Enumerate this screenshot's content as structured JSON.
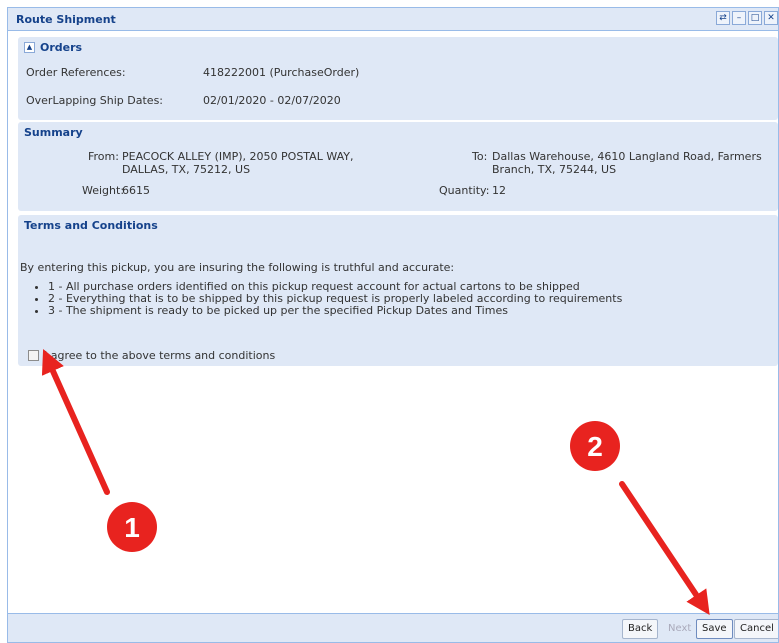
{
  "window": {
    "title": "Route Shipment"
  },
  "orders": {
    "heading": "Orders",
    "order_ref_label": "Order References:",
    "order_ref_value": "418222001 (PurchaseOrder)",
    "ship_dates_label": "OverLapping Ship Dates:",
    "ship_dates_value": "02/01/2020 - 02/07/2020"
  },
  "summary": {
    "heading": "Summary",
    "from_label": "From:",
    "from_line1": "PEACOCK ALLEY (IMP), 2050 POSTAL WAY,",
    "from_line2": "DALLAS, TX, 75212, US",
    "to_label": "To:",
    "to_line1": "Dallas Warehouse, 4610 Langland Road, Farmers",
    "to_line2": "Branch, TX, 75244, US",
    "weight_label": "Weight:",
    "weight_value": "6615",
    "quantity_label": "Quantity:",
    "quantity_value": "12"
  },
  "terms": {
    "heading": "Terms and Conditions",
    "intro": "By entering this pickup, you are insuring the following is truthful and accurate:",
    "items": [
      "1 - All purchase orders identified on this pickup request account for actual cartons to be shipped",
      "2 - Everything that is to be shipped by this pickup request is properly labeled according to requirements",
      "3 - The shipment is ready to be picked up per the specified Pickup Dates and Times"
    ],
    "agree_label": "I agree to the above terms and conditions"
  },
  "footer": {
    "back": "Back",
    "next": "Next",
    "save": "Save",
    "cancel": "Cancel"
  },
  "annotations": {
    "marker1": "1",
    "marker2": "2",
    "color": "#e8231f"
  }
}
